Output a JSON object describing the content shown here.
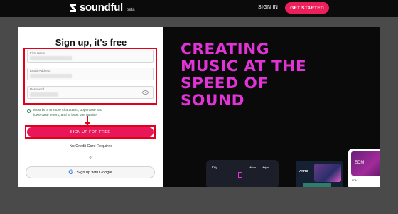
{
  "header": {
    "logo_text": "soundful",
    "logo_badge": "beta",
    "sign_in": "SIGN IN",
    "get_started": "GET STARTED"
  },
  "signup": {
    "title": "Sign up, it's free",
    "first_name_label": "First Name",
    "email_label": "Email Address",
    "password_label": "Password",
    "password_hint": "Must be 8 or more characters, uppercase and lowercase letters, and at least one number",
    "submit_label": "SIGN UP FOR FREE",
    "no_card": "No Credit Card Required",
    "or_text": "or",
    "google_label": "Sign up with Google"
  },
  "hero": {
    "line1": "CREATING",
    "line2": "MUSIC AT THE",
    "line3": "SPEED OF",
    "line4": "SOUND",
    "card_key_title": "Key",
    "card_key_major": "Minor",
    "card_key_minor": "Major",
    "card_afro_title": "AFRO",
    "card_edm_title": "EDM",
    "card_edm_foot": "EDM"
  },
  "colors": {
    "accent": "#ec1f5b",
    "headline": "#e233d8",
    "annotation": "#e4001b"
  }
}
